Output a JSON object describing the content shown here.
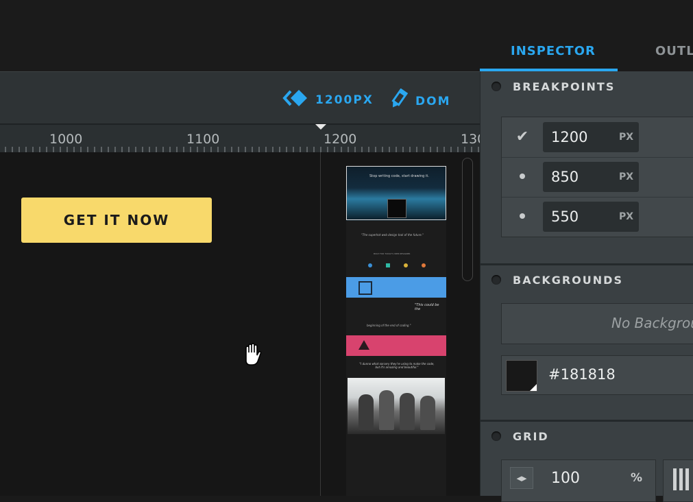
{
  "toolbar": {
    "width_label": "1200PX",
    "dom_label": "DOM"
  },
  "ruler": {
    "ticks": [
      "1000",
      "1100",
      "1200",
      "130"
    ]
  },
  "canvas": {
    "cta_label": "GET IT NOW"
  },
  "minimap": {
    "headline": "Stop writing code, start drawing it.",
    "quote1": "\"The superhot web design tool of the future.\"",
    "section": "BUILT FOR TODAY'S WEB DESIGNER",
    "quote2": "\"This could be the",
    "quote3": "beginning of the end of coding.\"",
    "quote4": "\"I dunno what sorcery they're using to make the code, but it's amazing and beautiful.\""
  },
  "tabs": {
    "active": "INSPECTOR",
    "other": "OUTL"
  },
  "breakpoints": {
    "title": "BREAKPOINTS",
    "rows": [
      {
        "value": "1200",
        "unit": "PX",
        "icon": "checkmark-icon"
      },
      {
        "value": "850",
        "unit": "PX",
        "icon": "dot-icon"
      },
      {
        "value": "550",
        "unit": "PX",
        "icon": "dot-icon"
      }
    ]
  },
  "backgrounds": {
    "title": "BACKGROUNDS",
    "placeholder": "No Backgrou",
    "color": "#181818"
  },
  "grid": {
    "title": "GRID",
    "value": "100",
    "unit": "%"
  },
  "colors": {
    "accent": "#2aa7f0",
    "cta": "#f8d96b",
    "panel": "#3a4043",
    "toolbar": "#2e3335"
  }
}
